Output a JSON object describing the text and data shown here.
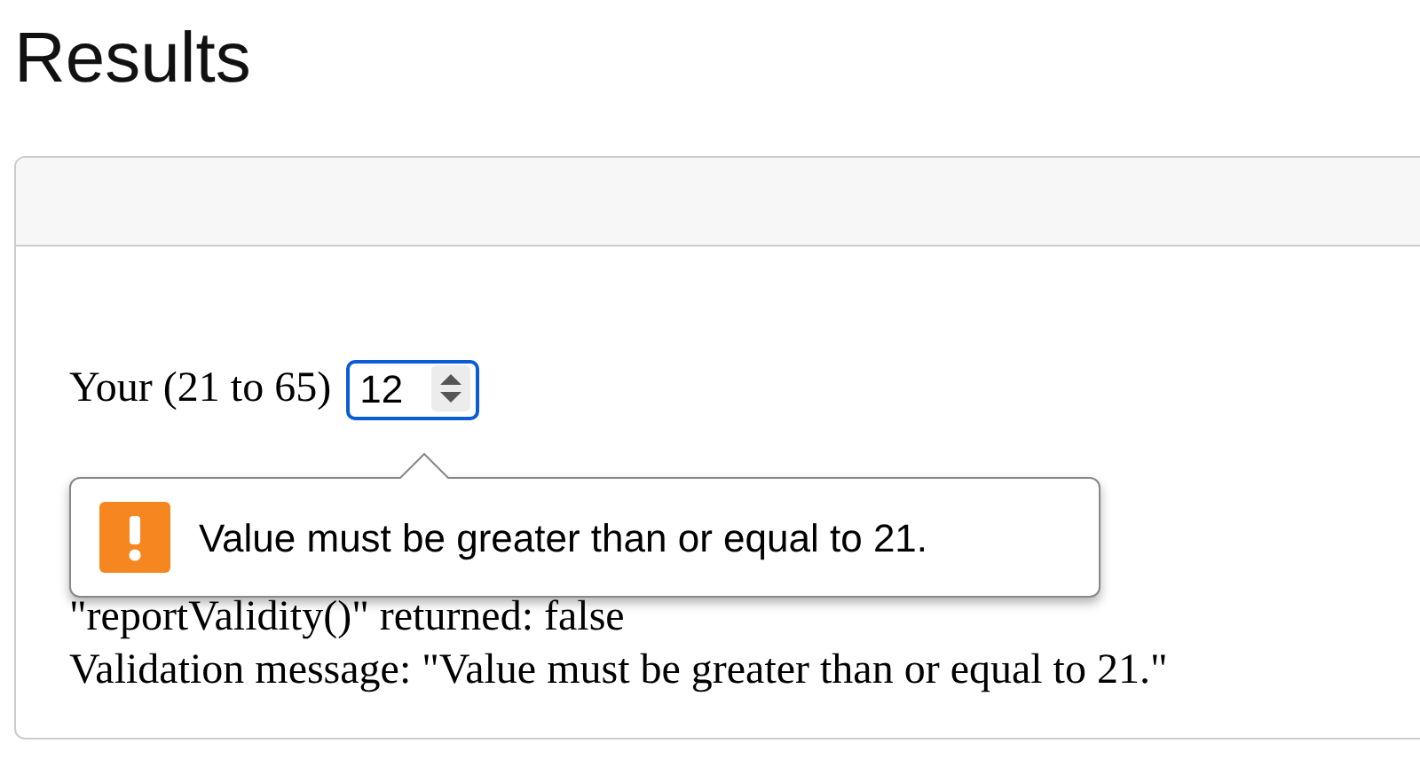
{
  "title": "Results",
  "form": {
    "label": "Your (21 to 65)",
    "input_value": "12"
  },
  "tooltip": {
    "message": "Value must be greater than or equal to 21."
  },
  "output_lines": [
    "\"reportValidity()\" returned: false",
    "Validation message: \"Value must be greater than or equal to 21.\""
  ]
}
